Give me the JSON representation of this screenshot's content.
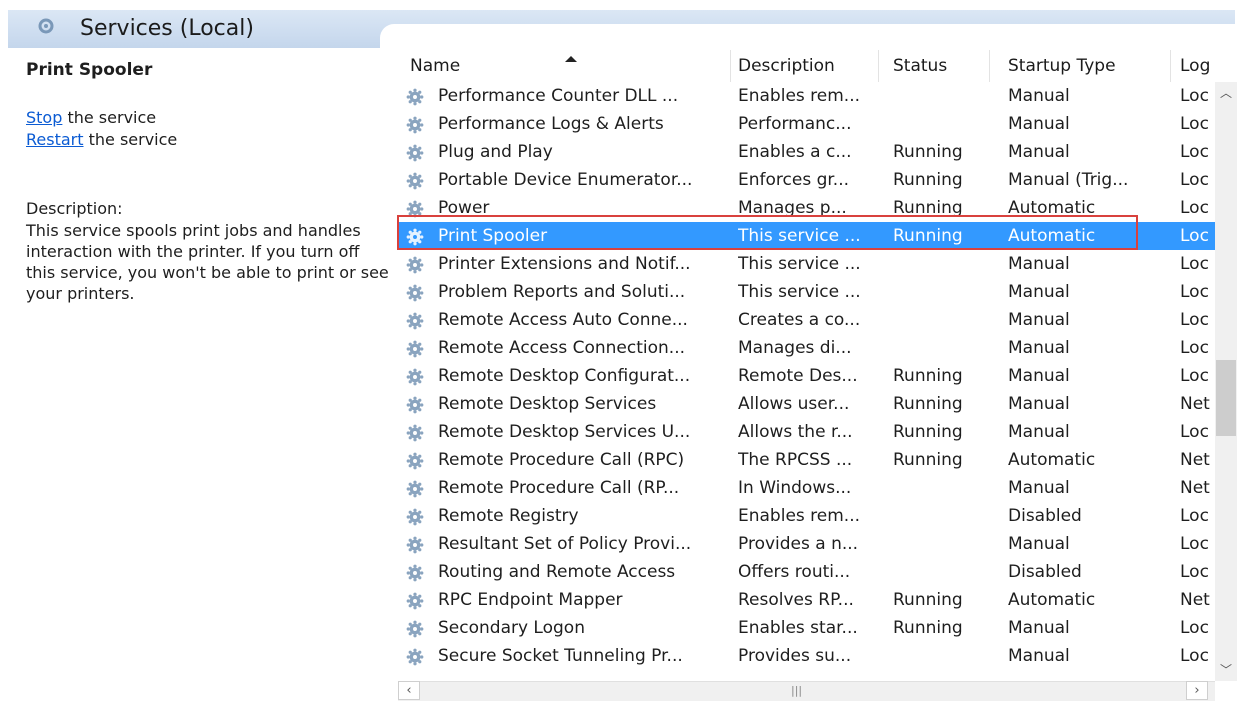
{
  "header": {
    "title": "Services (Local)"
  },
  "left_pane": {
    "service_name": "Print Spooler",
    "stop_link": "Stop",
    "stop_rest": " the service",
    "restart_link": "Restart",
    "restart_rest": " the service",
    "description_label": "Description:",
    "description": "This service spools print jobs and handles interaction with the printer. If you turn off this service, you won't be able to print or see your printers."
  },
  "columns": [
    "Name",
    "Description",
    "Status",
    "Startup Type",
    "Log"
  ],
  "rows": [
    {
      "name": "Performance Counter DLL ...",
      "description": "Enables rem...",
      "status": "",
      "startup": "Manual",
      "log": "Loc"
    },
    {
      "name": "Performance Logs & Alerts",
      "description": "Performanc...",
      "status": "",
      "startup": "Manual",
      "log": "Loc"
    },
    {
      "name": "Plug and Play",
      "description": "Enables a c...",
      "status": "Running",
      "startup": "Manual",
      "log": "Loc"
    },
    {
      "name": "Portable Device Enumerator...",
      "description": "Enforces gr...",
      "status": "Running",
      "startup": "Manual (Trig...",
      "log": "Loc"
    },
    {
      "name": "Power",
      "description": "Manages p...",
      "status": "Running",
      "startup": "Automatic",
      "log": "Loc"
    },
    {
      "name": "Print Spooler",
      "description": "This service ...",
      "status": "Running",
      "startup": "Automatic",
      "log": "Loc",
      "selected": true
    },
    {
      "name": "Printer Extensions and Notif...",
      "description": "This service ...",
      "status": "",
      "startup": "Manual",
      "log": "Loc"
    },
    {
      "name": "Problem Reports and Soluti...",
      "description": "This service ...",
      "status": "",
      "startup": "Manual",
      "log": "Loc"
    },
    {
      "name": "Remote Access Auto Conne...",
      "description": "Creates a co...",
      "status": "",
      "startup": "Manual",
      "log": "Loc"
    },
    {
      "name": "Remote Access Connection...",
      "description": "Manages di...",
      "status": "",
      "startup": "Manual",
      "log": "Loc"
    },
    {
      "name": "Remote Desktop Configurat...",
      "description": "Remote Des...",
      "status": "Running",
      "startup": "Manual",
      "log": "Loc"
    },
    {
      "name": "Remote Desktop Services",
      "description": "Allows user...",
      "status": "Running",
      "startup": "Manual",
      "log": "Net"
    },
    {
      "name": "Remote Desktop Services U...",
      "description": "Allows the r...",
      "status": "Running",
      "startup": "Manual",
      "log": "Loc"
    },
    {
      "name": "Remote Procedure Call (RPC)",
      "description": "The RPCSS ...",
      "status": "Running",
      "startup": "Automatic",
      "log": "Net"
    },
    {
      "name": "Remote Procedure Call (RP...",
      "description": "In Windows...",
      "status": "",
      "startup": "Manual",
      "log": "Net"
    },
    {
      "name": "Remote Registry",
      "description": "Enables rem...",
      "status": "",
      "startup": "Disabled",
      "log": "Loc"
    },
    {
      "name": "Resultant Set of Policy Provi...",
      "description": "Provides a n...",
      "status": "",
      "startup": "Manual",
      "log": "Loc"
    },
    {
      "name": "Routing and Remote Access",
      "description": "Offers routi...",
      "status": "",
      "startup": "Disabled",
      "log": "Loc"
    },
    {
      "name": "RPC Endpoint Mapper",
      "description": "Resolves RP...",
      "status": "Running",
      "startup": "Automatic",
      "log": "Net"
    },
    {
      "name": "Secondary Logon",
      "description": "Enables star...",
      "status": "Running",
      "startup": "Manual",
      "log": "Loc"
    },
    {
      "name": "Secure Socket Tunneling Pr...",
      "description": "Provides su...",
      "status": "",
      "startup": "Manual",
      "log": "Loc"
    }
  ],
  "icons": {
    "header": "services-icon",
    "row": "gear-icon",
    "sort": "sort-ascending-icon"
  },
  "colors": {
    "selection": "#3399ff",
    "highlight_box": "#d9413d",
    "link": "#0b5bd3"
  }
}
